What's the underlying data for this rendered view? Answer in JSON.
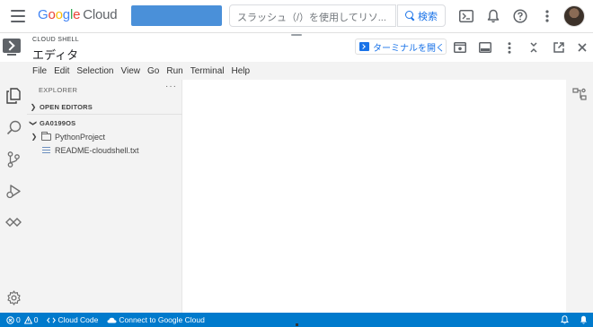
{
  "topbar": {
    "logo": {
      "g1": "G",
      "g2": "o",
      "g3": "o",
      "g4": "g",
      "g5": "l",
      "g6": "e",
      "cloud": "Cloud"
    },
    "search": {
      "placeholder": "スラッシュ（/）を使用してリソ...",
      "button_label": "検索"
    }
  },
  "cloud_shell": {
    "caption": "CLOUD SHELL",
    "title": "エディタ",
    "open_terminal_label": "ターミナルを開く"
  },
  "menubar": {
    "items": [
      "File",
      "Edit",
      "Selection",
      "View",
      "Go",
      "Run",
      "Terminal",
      "Help"
    ]
  },
  "explorer": {
    "title": "EXPLORER",
    "more": "···",
    "open_editors": "OPEN EDITORS",
    "workspace": "GA0199OS",
    "tree": {
      "folder": "PythonProject",
      "file": "README-cloudshell.txt"
    }
  },
  "statusbar": {
    "errors": "0",
    "warnings": "0",
    "cloud_code": "Cloud Code",
    "connect": "Connect to Google Cloud"
  },
  "colors": {
    "accent": "#1a73e8",
    "statusbar": "#007acc",
    "project_picker": "#4a90d9"
  }
}
